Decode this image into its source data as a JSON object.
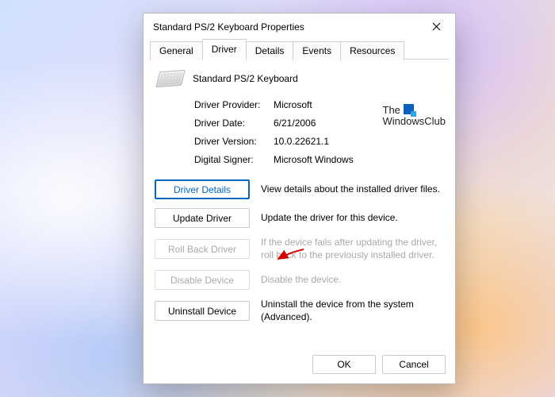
{
  "window": {
    "title": "Standard PS/2 Keyboard Properties"
  },
  "tabs": {
    "general": "General",
    "driver": "Driver",
    "details": "Details",
    "events": "Events",
    "resources": "Resources",
    "active": "Driver"
  },
  "device": {
    "name": "Standard PS/2 Keyboard"
  },
  "info": {
    "provider_label": "Driver Provider:",
    "provider_value": "Microsoft",
    "date_label": "Driver Date:",
    "date_value": "6/21/2006",
    "version_label": "Driver Version:",
    "version_value": "10.0.22621.1",
    "signer_label": "Digital Signer:",
    "signer_value": "Microsoft Windows"
  },
  "watermark": {
    "line1": "The",
    "line2": "WindowsClub"
  },
  "actions": {
    "details": {
      "label": "Driver Details",
      "desc": "View details about the installed driver files."
    },
    "update": {
      "label": "Update Driver",
      "desc": "Update the driver for this device."
    },
    "rollback": {
      "label": "Roll Back Driver",
      "desc": "If the device fails after updating the driver, roll back to the previously installed driver."
    },
    "disable": {
      "label": "Disable Device",
      "desc": "Disable the device."
    },
    "uninstall": {
      "label": "Uninstall Device",
      "desc": "Uninstall the device from the system (Advanced)."
    }
  },
  "footer": {
    "ok": "OK",
    "cancel": "Cancel"
  }
}
